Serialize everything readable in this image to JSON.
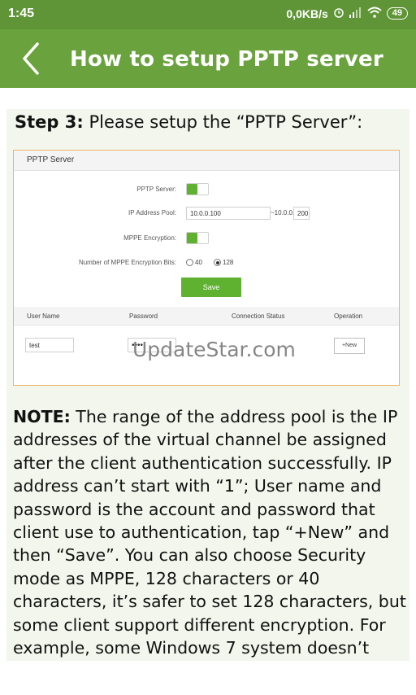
{
  "status_bar": {
    "time": "1:45",
    "network_speed": "0,0KB/s",
    "battery": "49"
  },
  "app_bar": {
    "title": "How to setup PPTP server"
  },
  "step": {
    "label": "Step 3:",
    "text": " Please setup the “PPTP Server”:"
  },
  "pptp_panel": {
    "header": "PPTP Server",
    "pptp_server_label": "PPTP Server:",
    "ip_pool_label": "IP Address Pool:",
    "ip_pool_start": "10.0.0.100",
    "ip_pool_separator": "~10.0.0.",
    "ip_pool_end": "200",
    "mppe_label": "MPPE Encryption:",
    "bits_label": "Number of MPPE Encryption Bits:",
    "bits_40": "40",
    "bits_128": "128",
    "save_button": "Save",
    "columns": [
      "User Name",
      "Password",
      "Connection Status",
      "Operation"
    ],
    "row": {
      "user_name": "test",
      "password": "••••"
    },
    "new_button": "+New"
  },
  "watermark": "UpdateStar.com",
  "note": {
    "label": "NOTE:",
    "text": " The range of the address pool is the IP addresses of the virtual channel be assigned after the client authentication successfully. IP address can’t start with “1”; User name and password is the account and password that client use to authentication, tap “+New” and then “Save”. You can also choose Security mode as MPPE, 128 characters or 40 characters, it’s safer to set 128 characters, but some client support different encryption. For example, some Windows 7 system doesn’t"
  },
  "colors": {
    "status_bar": "#5f9536",
    "app_bar": "#6aa33d",
    "accent_green": "#5fb22f",
    "panel_border": "#f0b46a",
    "content_bg": "#f2f6ec"
  }
}
